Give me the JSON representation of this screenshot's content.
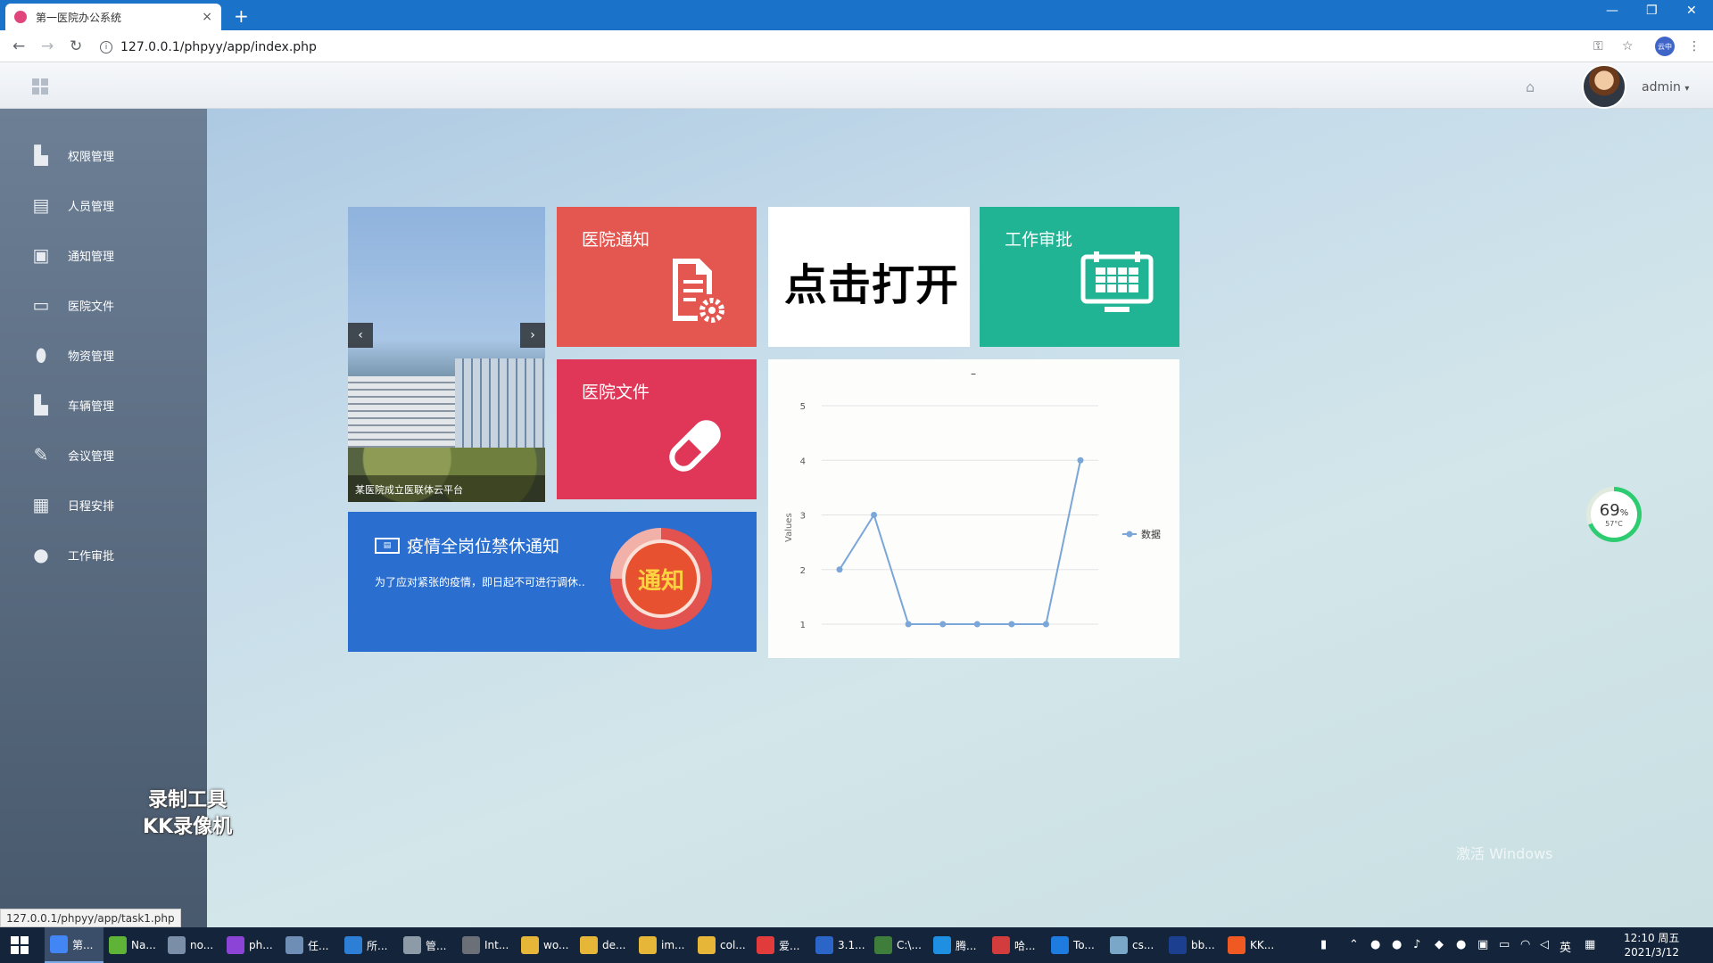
{
  "browser": {
    "tab_title": "第一医院办公系统",
    "tab_close": "×",
    "new_tab": "+",
    "url": "127.0.0.1/phpyy/app/index.php",
    "profile_label": "云中",
    "status_url": "127.0.0.1/phpyy/app/task1.php"
  },
  "header": {
    "username": "admin",
    "username_caret": "▾"
  },
  "sidebar": {
    "items": [
      {
        "label": "权限管理",
        "icon": "bar-chart-icon"
      },
      {
        "label": "人员管理",
        "icon": "document-gear-icon"
      },
      {
        "label": "通知管理",
        "icon": "notice-icon"
      },
      {
        "label": "医院文件",
        "icon": "monitor-icon"
      },
      {
        "label": "物资管理",
        "icon": "pill-icon"
      },
      {
        "label": "车辆管理",
        "icon": "bar-chart-icon"
      },
      {
        "label": "会议管理",
        "icon": "pencil-icon"
      },
      {
        "label": "日程安排",
        "icon": "calendar-icon"
      },
      {
        "label": "工作审批",
        "icon": "person-icon"
      }
    ]
  },
  "tiles": {
    "slider": {
      "caption": "某医院成立医联体云平台",
      "prev": "‹",
      "next": "›"
    },
    "notice": {
      "title": "医院通知",
      "icon": "document-gear-icon",
      "color": "#e45650"
    },
    "open": {
      "label": "点击打开"
    },
    "approve": {
      "title": "工作审批",
      "icon": "calendar-monitor-icon",
      "color": "#20b494"
    },
    "file": {
      "title": "医院文件",
      "icon": "pill-icon",
      "color": "#e03658"
    },
    "epidemic": {
      "title": "疫情全岗位禁休通知",
      "text": "为了应对紧张的疫情，即日起不可进行调休..",
      "badge": "通知",
      "color": "#2a6fcf"
    }
  },
  "chart_data": {
    "type": "line",
    "title": "–",
    "xlabel": "",
    "ylabel": "Values",
    "ylim": [
      1,
      5
    ],
    "yticks": [
      1,
      2,
      3,
      4,
      5
    ],
    "x": [
      1,
      2,
      3,
      4,
      5,
      6,
      7,
      8
    ],
    "series": [
      {
        "name": "数据",
        "values": [
          2,
          3,
          1,
          1,
          1,
          1,
          1,
          4
        ],
        "color": "#7aa6d8"
      }
    ],
    "grid": true,
    "legend": "right"
  },
  "gauge": {
    "percent": "69",
    "unit": "%",
    "temp": "57°C",
    "value": 0.69
  },
  "watermark": {
    "line1": "录制工具",
    "line2": "KK录像机"
  },
  "activate": "激活 Windows",
  "taskbar": {
    "items": [
      "第...",
      "Na...",
      "no...",
      "ph...",
      "任...",
      "所...",
      "管...",
      "Int...",
      "wo...",
      "de...",
      "im...",
      "col...",
      "爱...",
      "3.1...",
      "C:\\...",
      "腾...",
      "哈...",
      "To...",
      "cs...",
      "bb...",
      "KK..."
    ],
    "ime": "英",
    "time": "12:10 周五",
    "date": "2021/3/12"
  }
}
